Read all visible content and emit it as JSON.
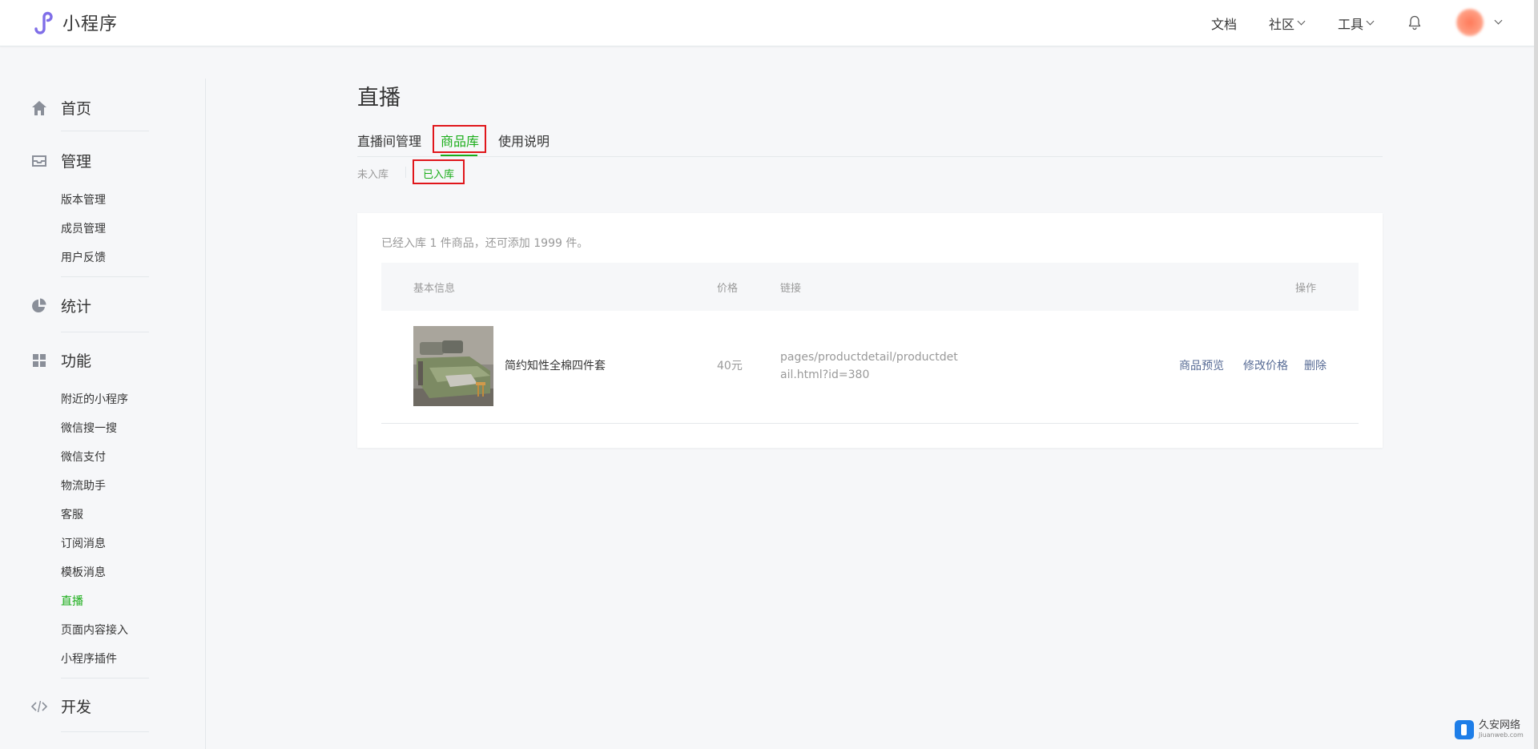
{
  "header": {
    "app_name": "小程序",
    "nav": {
      "docs": "文档",
      "community": "社区",
      "tools": "工具"
    }
  },
  "sidebar": {
    "home": "首页",
    "manage": {
      "label": "管理",
      "items": [
        "版本管理",
        "成员管理",
        "用户反馈"
      ]
    },
    "stats": "统计",
    "features": {
      "label": "功能",
      "items": [
        "附近的小程序",
        "微信搜一搜",
        "微信支付",
        "物流助手",
        "客服",
        "订阅消息",
        "模板消息",
        "直播",
        "页面内容接入",
        "小程序插件"
      ],
      "active": "直播"
    },
    "dev": "开发"
  },
  "main": {
    "title": "直播",
    "tabs": [
      "直播间管理",
      "商品库",
      "使用说明"
    ],
    "active_tab": "商品库",
    "subtabs": [
      "未入库",
      "已入库"
    ],
    "active_subtab": "已入库",
    "summary": "已经入库 1 件商品，还可添加 1999 件。",
    "table": {
      "headers": {
        "info": "基本信息",
        "price": "价格",
        "link": "链接",
        "action": "操作"
      },
      "rows": [
        {
          "name": "简约知性全棉四件套",
          "price": "40元",
          "link": "pages/productdetail/productdetail.html?id=380",
          "actions": [
            "商品预览",
            "修改价格",
            "删除"
          ]
        }
      ]
    }
  },
  "watermark": {
    "cn": "久安网络",
    "en": "Jiuanweb.com"
  },
  "colors": {
    "accent": "#1aad19",
    "link": "#576b95",
    "highlight_box": "#e0161b"
  }
}
